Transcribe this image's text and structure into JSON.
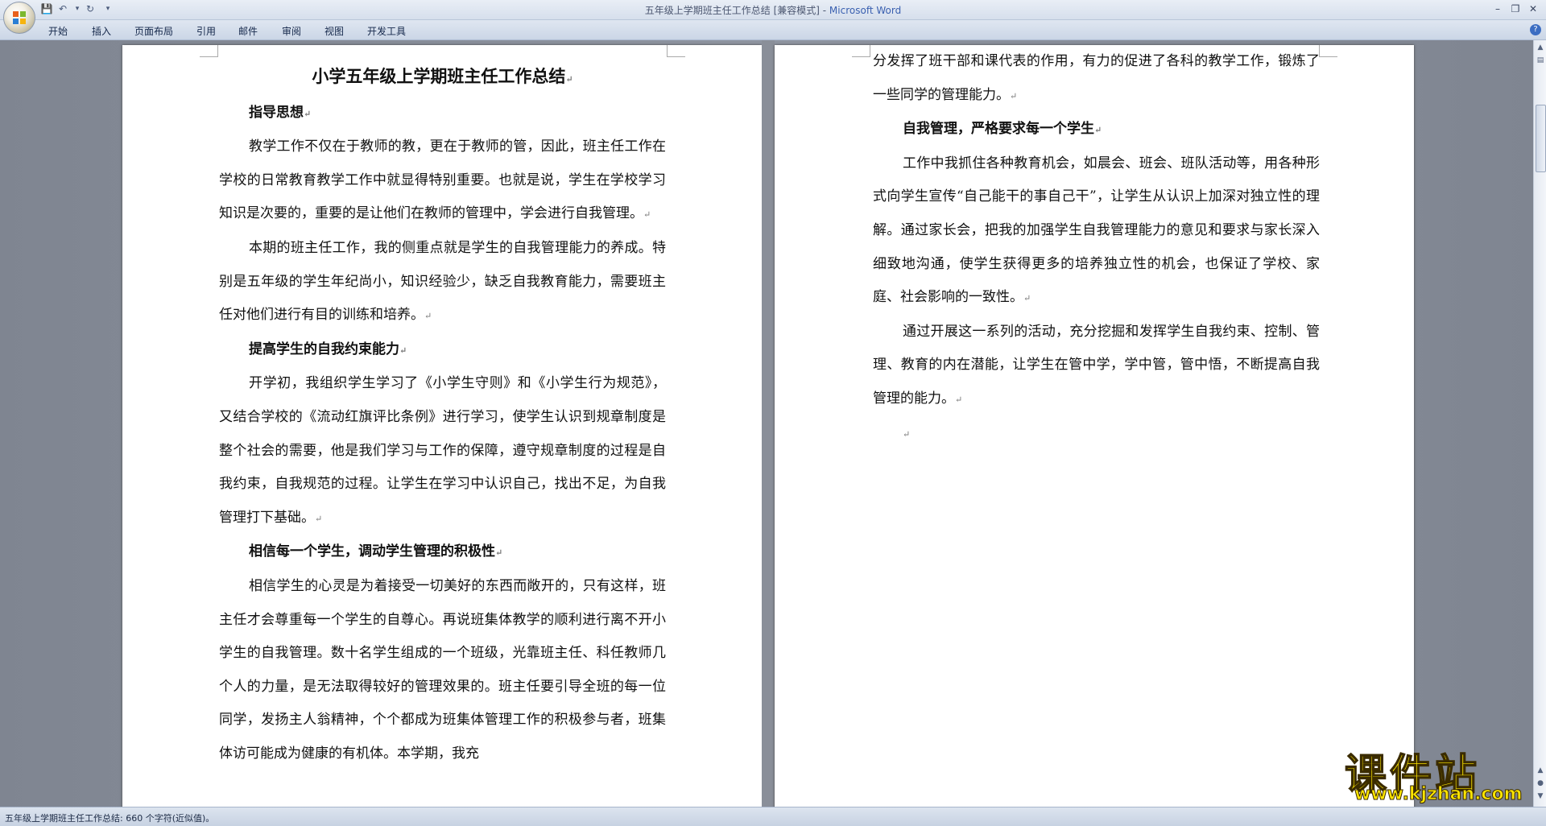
{
  "window": {
    "title_doc": "五年级上学期班主任工作总结 [兼容模式] - ",
    "title_app": "Microsoft Word"
  },
  "qat": {
    "save_icon": "save-icon",
    "undo_icon": "undo-icon",
    "redo_icon": "redo-icon"
  },
  "tabs": [
    "开始",
    "插入",
    "页面布局",
    "引用",
    "邮件",
    "审阅",
    "视图",
    "开发工具"
  ],
  "page1": {
    "title": "小学五年级上学期班主任工作总结",
    "h1": "指导思想",
    "p1": "教学工作不仅在于教师的教，更在于教师的管，因此，班主任工作在学校的日常教育教学工作中就显得特别重要。也就是说，学生在学校学习知识是次要的，重要的是让他们在教师的管理中，学会进行自我管理。",
    "p2": "本期的班主任工作，我的侧重点就是学生的自我管理能力的养成。特别是五年级的学生年纪尚小，知识经验少，缺乏自我教育能力，需要班主任对他们进行有目的训练和培养。",
    "h2": "提高学生的自我约束能力",
    "p3": "开学初，我组织学生学习了《小学生守则》和《小学生行为规范》，又结合学校的《流动红旗评比条例》进行学习，使学生认识到规章制度是整个社会的需要，他是我们学习与工作的保障，遵守规章制度的过程是自我约束，自我规范的过程。让学生在学习中认识自己，找出不足，为自我管理打下基础。",
    "h3": "相信每一个学生，调动学生管理的积极性",
    "p4": "相信学生的心灵是为着接受一切美好的东西而敞开的，只有这样，班主任才会尊重每一个学生的自尊心。再说班集体教学的顺利进行离不开小学生的自我管理。数十名学生组成的一个班级，光靠班主任、科任教师几个人的力量，是无法取得较好的管理效果的。班主任要引导全班的每一位同学，发扬主人翁精神，个个都成为班集体管理工作的积极参与者，班集体访可能成为健康的有机体。本学期，我充"
  },
  "page2": {
    "p0": "分发挥了班干部和课代表的作用，有力的促进了各科的教学工作，锻炼了一些同学的管理能力。",
    "h1": "自我管理，严格要求每一个学生",
    "p1": "工作中我抓住各种教育机会，如晨会、班会、班队活动等，用各种形式向学生宣传“自己能干的事自己干”，让学生从认识上加深对独立性的理解。通过家长会，把我的加强学生自我管理能力的意见和要求与家长深入细致地沟通，使学生获得更多的培养独立性的机会，也保证了学校、家庭、社会影响的一致性。",
    "p2": "通过开展这一系列的活动，充分挖掘和发挥学生自我约束、控制、管理、教育的内在潜能，让学生在管中学，学中管，管中悟，不断提高自我管理的能力。"
  },
  "para_mark": "↵",
  "status": {
    "text": "五年级上学期班主任工作总结: 660 个字符(近似值)。"
  },
  "watermark": {
    "title": "课件站",
    "url": "www.kjzhan.com"
  }
}
